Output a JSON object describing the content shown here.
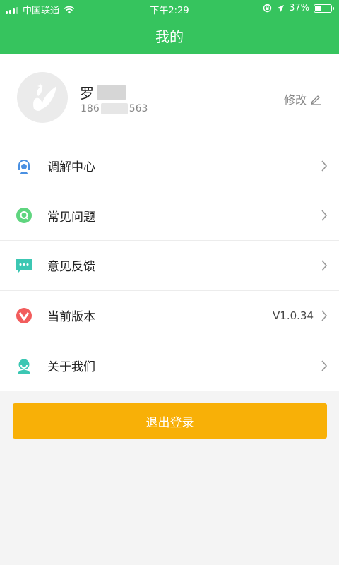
{
  "status_bar": {
    "carrier": "中国联通",
    "time": "下午2:29",
    "battery_percent": "37%",
    "battery_level": 0.37
  },
  "header": {
    "title": "我的"
  },
  "profile": {
    "name_visible": "罗",
    "phone_prefix": "186",
    "phone_suffix": "563",
    "edit_label": "修改"
  },
  "menu": {
    "items": [
      {
        "label": "调解中心",
        "icon": "headset-icon",
        "color": "#4a90e2",
        "value": ""
      },
      {
        "label": "常见问题",
        "icon": "question-icon",
        "color": "#5fd57f",
        "value": ""
      },
      {
        "label": "意见反馈",
        "icon": "chat-icon",
        "color": "#3cc7b3",
        "value": ""
      },
      {
        "label": "当前版本",
        "icon": "version-icon",
        "color": "#f25c5c",
        "value": "V1.0.34"
      },
      {
        "label": "关于我们",
        "icon": "about-icon",
        "color": "#3cc7b3",
        "value": ""
      }
    ]
  },
  "logout": {
    "label": "退出登录"
  },
  "colors": {
    "header_green": "#36c45e",
    "logout_orange": "#f8b007"
  }
}
